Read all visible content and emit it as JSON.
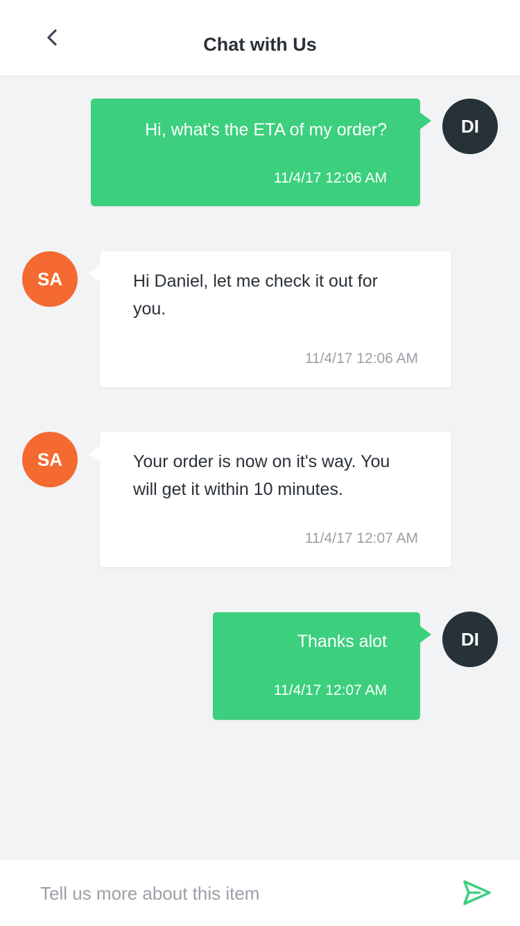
{
  "header": {
    "title": "Chat with Us",
    "back_icon": "chevron-left-icon"
  },
  "messages": [
    {
      "sender": "me",
      "avatar_initials": "DI",
      "text": "Hi, what's the ETA of my order?",
      "time": "11/4/17 12:06 AM"
    },
    {
      "sender": "agent",
      "avatar_initials": "SA",
      "text_lines": [
        "Hi Daniel, let me check it out for",
        "you."
      ],
      "time": "11/4/17 12:06 AM"
    },
    {
      "sender": "agent",
      "avatar_initials": "SA",
      "text_lines": [
        "Your order is now on it's way. You",
        "will get it within 10 minutes."
      ],
      "time": "11/4/17 12:07 AM"
    },
    {
      "sender": "me",
      "avatar_initials": "DI",
      "text": "Thanks alot",
      "time": "11/4/17 12:07 AM"
    }
  ],
  "composer": {
    "placeholder": "Tell us more about this item",
    "value": "",
    "send_icon": "send-icon"
  },
  "colors": {
    "outgoing_bubble": "#3ccf7d",
    "incoming_bubble": "#ffffff",
    "my_avatar": "#263238",
    "agent_avatar": "#f46a30",
    "background": "#f2f3f5",
    "send_icon": "#3ccf7d"
  }
}
